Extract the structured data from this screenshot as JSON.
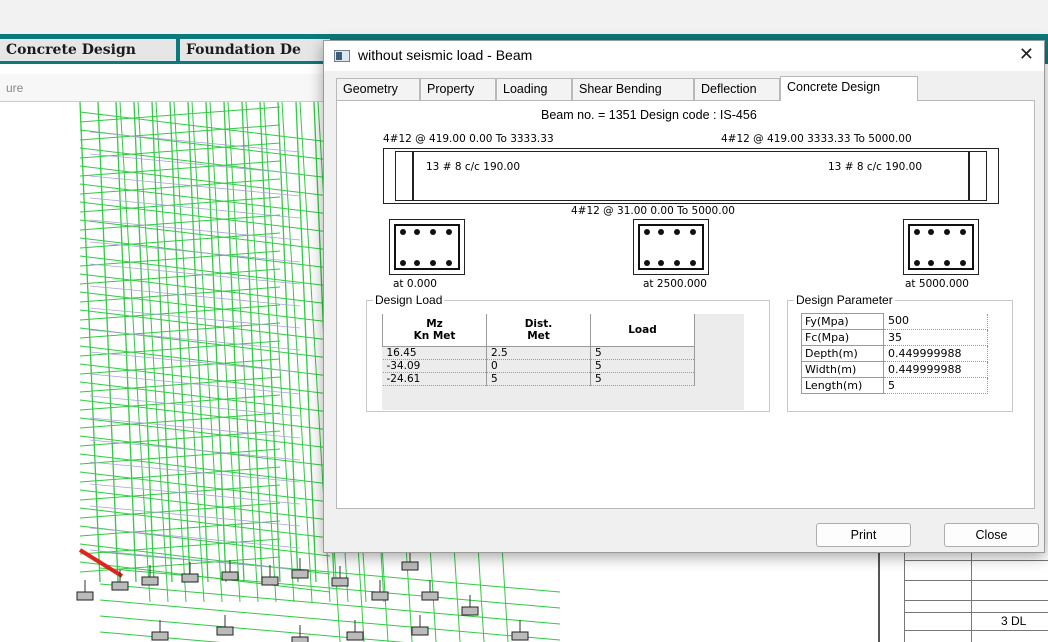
{
  "app": {
    "tabs": [
      "Concrete Design",
      "Foundation De"
    ],
    "toolbar_text": "ure",
    "side_panel_text": "3 DL"
  },
  "dialog": {
    "title": "without seismic load - Beam",
    "close_glyph": "✕",
    "tabs": [
      "Geometry",
      "Property",
      "Loading",
      "Shear Bending",
      "Deflection",
      "Concrete Design"
    ],
    "active_tab": "Concrete Design",
    "beam_info": "Beam no. = 1351  Design code :  IS-456",
    "top_left_rebar": "4#12 @ 419.00 0.00 To 3333.33",
    "top_right_rebar": "4#12 @ 419.00 3333.33 To 5000.00",
    "stirrup_left": "13 # 8 c/c 190.00",
    "stirrup_right": "13 # 8 c/c 190.00",
    "bottom_rebar": "4#12 @ 31.00 0.00 To 5000.00",
    "sections": [
      "at 0.000",
      "at 2500.000",
      "at 5000.000"
    ],
    "design_load": {
      "legend": "Design Load",
      "headers": [
        [
          "Mz",
          "Kn Met"
        ],
        [
          "Dist.",
          "Met"
        ],
        [
          "Load"
        ]
      ],
      "rows": [
        [
          "16.45",
          "2.5",
          "5"
        ],
        [
          "-34.09",
          "0",
          "5"
        ],
        [
          "-24.61",
          "5",
          "5"
        ]
      ]
    },
    "design_parameter": {
      "legend": "Design Parameter",
      "rows": [
        {
          "key": "Fy(Mpa)",
          "value": "500"
        },
        {
          "key": "Fc(Mpa)",
          "value": "35"
        },
        {
          "key": "Depth(m)",
          "value": "0.449999988"
        },
        {
          "key": "Width(m)",
          "value": "0.449999988"
        },
        {
          "key": "Length(m)",
          "value": "5"
        }
      ]
    },
    "buttons": {
      "print": "Print",
      "close": "Close"
    }
  }
}
